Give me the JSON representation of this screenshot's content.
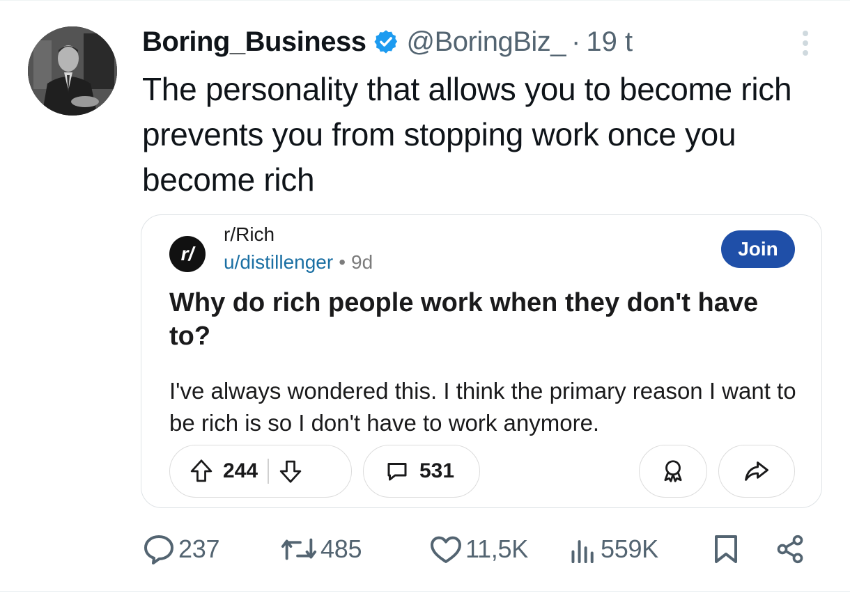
{
  "tweet": {
    "display_name": "Boring_Business",
    "handle": "@BoringBiz_",
    "separator": "·",
    "time": "19 t",
    "text": "The personality that allows you to become rich prevents you from stopping work once you become rich",
    "icons": {
      "avatar": "avatar-photo",
      "verified": "verified-badge-icon",
      "more": "more-options-icon"
    },
    "colors": {
      "verified": "#1d9bf0",
      "secondary_text": "#536471"
    }
  },
  "embed": {
    "subreddit_icon_text": "r/",
    "subreddit": "r/Rich",
    "user": "u/distillenger",
    "separator": "•",
    "age": "9d",
    "join_label": "Join",
    "title": "Why do rich people work when they don't have to?",
    "body": "I've always wondered this. I think the primary reason I want to be rich is so I don't have to work anymore.",
    "upvotes": "244",
    "comments": "531",
    "icons": {
      "upvote": "upvote-arrow-icon",
      "downvote": "downvote-arrow-icon",
      "comment": "comment-bubble-icon",
      "award": "award-icon",
      "share": "share-arrow-icon"
    },
    "colors": {
      "join_button": "#1f4fa8",
      "user_link": "#1a6fa3"
    }
  },
  "actions": {
    "replies": "237",
    "retweets": "485",
    "likes": "11,5K",
    "views": "559K",
    "icons": {
      "reply": "reply-icon",
      "retweet": "retweet-icon",
      "like": "heart-icon",
      "views": "views-chart-icon",
      "bookmark": "bookmark-icon",
      "share": "share-nodes-icon"
    }
  }
}
